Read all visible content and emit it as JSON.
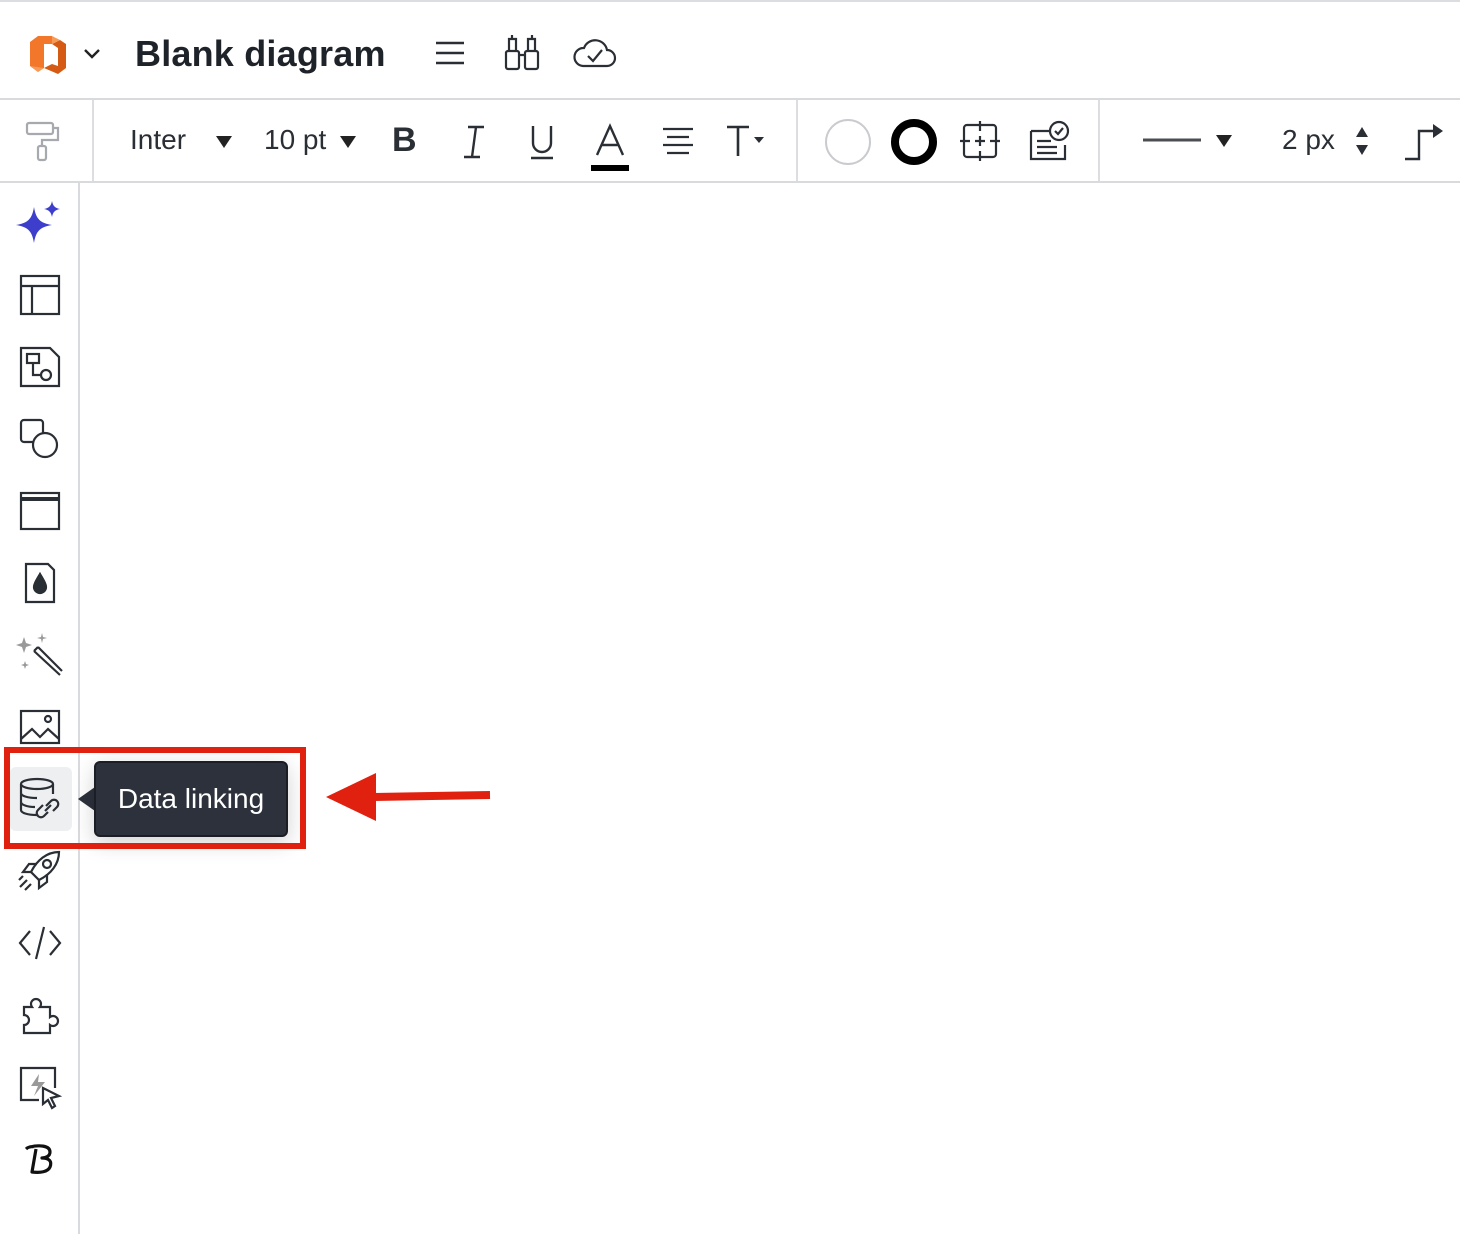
{
  "header": {
    "title": "Blank diagram",
    "icons": [
      "app-logo",
      "chevron-down-icon",
      "menu-icon",
      "binoculars-icon",
      "cloud-saved-icon"
    ]
  },
  "toolbar": {
    "font_family": "Inter",
    "font_size": "10 pt",
    "bold_label": "B",
    "italic_label": "I",
    "underline_label": "U",
    "text_color_label": "A",
    "text_options_label": "T",
    "line_width": "2 px"
  },
  "sidebar": {
    "items": [
      {
        "name": "ai-sparkle"
      },
      {
        "name": "templates"
      },
      {
        "name": "diagram-shapes"
      },
      {
        "name": "shapes"
      },
      {
        "name": "frame"
      },
      {
        "name": "theme"
      },
      {
        "name": "magic-wand"
      },
      {
        "name": "image"
      },
      {
        "name": "data-linking"
      },
      {
        "name": "rocket"
      },
      {
        "name": "code"
      },
      {
        "name": "integrations"
      },
      {
        "name": "actions"
      },
      {
        "name": "brand"
      }
    ]
  },
  "tooltip": {
    "text": "Data linking"
  },
  "annotation": {
    "color": "#e0210f"
  },
  "colors": {
    "accent": "#3d3fcc",
    "logo_orange": "#f2772a",
    "logo_dark_orange": "#d55a14"
  }
}
